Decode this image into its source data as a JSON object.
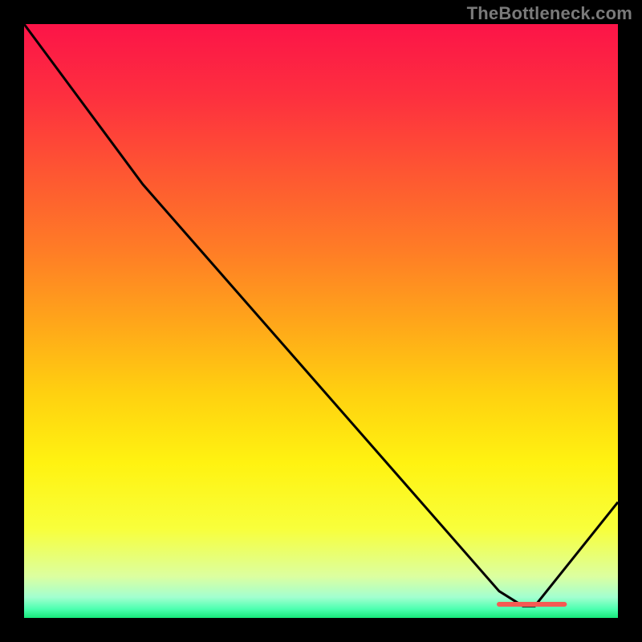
{
  "watermark": "TheBottleneck.com",
  "chart_data": {
    "type": "line",
    "title": "",
    "xlabel": "",
    "ylabel": "",
    "xlim": [
      0,
      100
    ],
    "ylim": [
      0,
      100
    ],
    "x": [
      0,
      20,
      80,
      84,
      86,
      100
    ],
    "values": [
      100,
      73,
      4.5,
      2,
      2,
      19.5
    ],
    "gradient_stops": [
      {
        "offset": 0.0,
        "color": "#fc1448"
      },
      {
        "offset": 0.12,
        "color": "#fd2f3f"
      },
      {
        "offset": 0.25,
        "color": "#fe5632"
      },
      {
        "offset": 0.38,
        "color": "#ff7c26"
      },
      {
        "offset": 0.5,
        "color": "#ffa51a"
      },
      {
        "offset": 0.62,
        "color": "#ffd010"
      },
      {
        "offset": 0.74,
        "color": "#fff311"
      },
      {
        "offset": 0.85,
        "color": "#f8ff3b"
      },
      {
        "offset": 0.93,
        "color": "#dcffa0"
      },
      {
        "offset": 0.965,
        "color": "#a3ffd0"
      },
      {
        "offset": 0.985,
        "color": "#4dffb0"
      },
      {
        "offset": 1.0,
        "color": "#17e87a"
      }
    ],
    "marker": {
      "x_start": 80,
      "x_end": 91,
      "y": 2.3,
      "color": "#f45a53",
      "thickness": 6
    }
  }
}
